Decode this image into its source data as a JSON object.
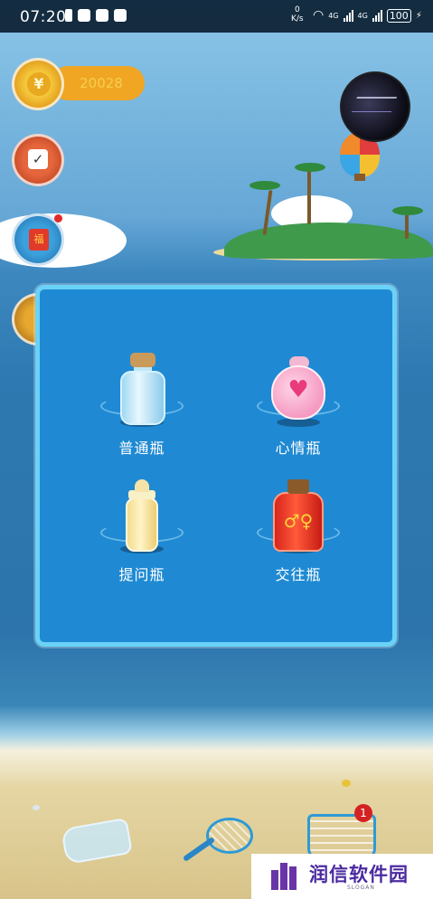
{
  "status_bar": {
    "time": "07:20",
    "net_speed_value": "0",
    "net_speed_unit": "K/s",
    "network_1": "4G",
    "network_2": "4G",
    "battery": "100"
  },
  "game": {
    "coins": "20028",
    "icons": {
      "coin": "yen-coin-icon",
      "checkin": "check-in-icon",
      "redpacket": "red-packet-icon",
      "gift": "gift-box-icon"
    }
  },
  "dialog": {
    "options": [
      {
        "label": "普通瓶",
        "icon": "glass-bottle-icon"
      },
      {
        "label": "心情瓶",
        "icon": "heart-bottle-icon"
      },
      {
        "label": "提问瓶",
        "icon": "baby-bottle-icon"
      },
      {
        "label": "交往瓶",
        "icon": "gender-bottle-icon"
      }
    ]
  },
  "bottom_bar": {
    "basket_badge": "1"
  },
  "watermark": {
    "title": "润信软件园",
    "slogan": "SLOGAN"
  },
  "colors": {
    "dialog_bg": "#1f8ad3",
    "dialog_border": "#6ad2f7",
    "coin": "#f0a523"
  }
}
